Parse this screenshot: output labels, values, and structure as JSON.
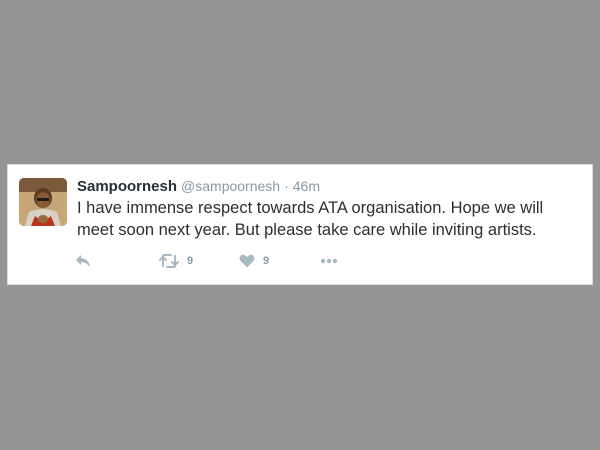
{
  "tweet": {
    "display_name": "Sampoornesh",
    "handle": "@sampoornesh",
    "separator": "·",
    "time": "46m",
    "text": "I have immense respect towards ATA organisation. Hope we will meet soon next year. But please take care while inviting artists.",
    "avatar_icon": "profile-photo",
    "actions": {
      "reply_icon": "reply-icon",
      "retweet_icon": "retweet-icon",
      "retweet_count": "9",
      "like_icon": "heart-icon",
      "like_count": "9",
      "more_icon": "more-options-icon"
    }
  },
  "colors": {
    "background": "#959595",
    "card": "#ffffff",
    "name_text": "#292f33",
    "muted_text": "#8899a6",
    "icon": "#aab8c2"
  }
}
